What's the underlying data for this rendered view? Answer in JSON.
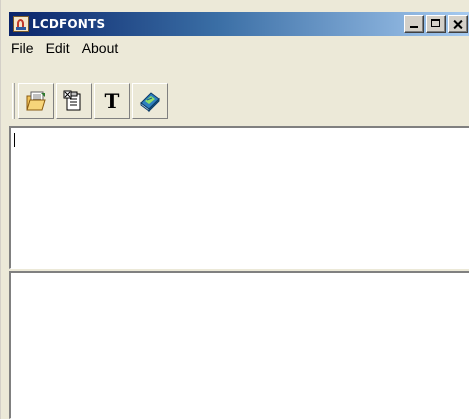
{
  "window": {
    "title": "LCDFONTS",
    "controls": {
      "minimize": "minimize",
      "maximize": "maximize",
      "close": "close"
    }
  },
  "menu": {
    "items": [
      {
        "label": "File"
      },
      {
        "label": "Edit"
      },
      {
        "label": "About"
      }
    ]
  },
  "toolbar": {
    "buttons": [
      {
        "icon": "open-file-icon"
      },
      {
        "icon": "paste-icon"
      },
      {
        "icon": "font-icon",
        "glyph": "T"
      },
      {
        "icon": "book-icon"
      }
    ]
  },
  "editor": {
    "input_text": "",
    "output_text": ""
  },
  "colors": {
    "titlebar_start": "#0a246a",
    "titlebar_end": "#a6caf0",
    "chrome": "#ece9d8"
  }
}
